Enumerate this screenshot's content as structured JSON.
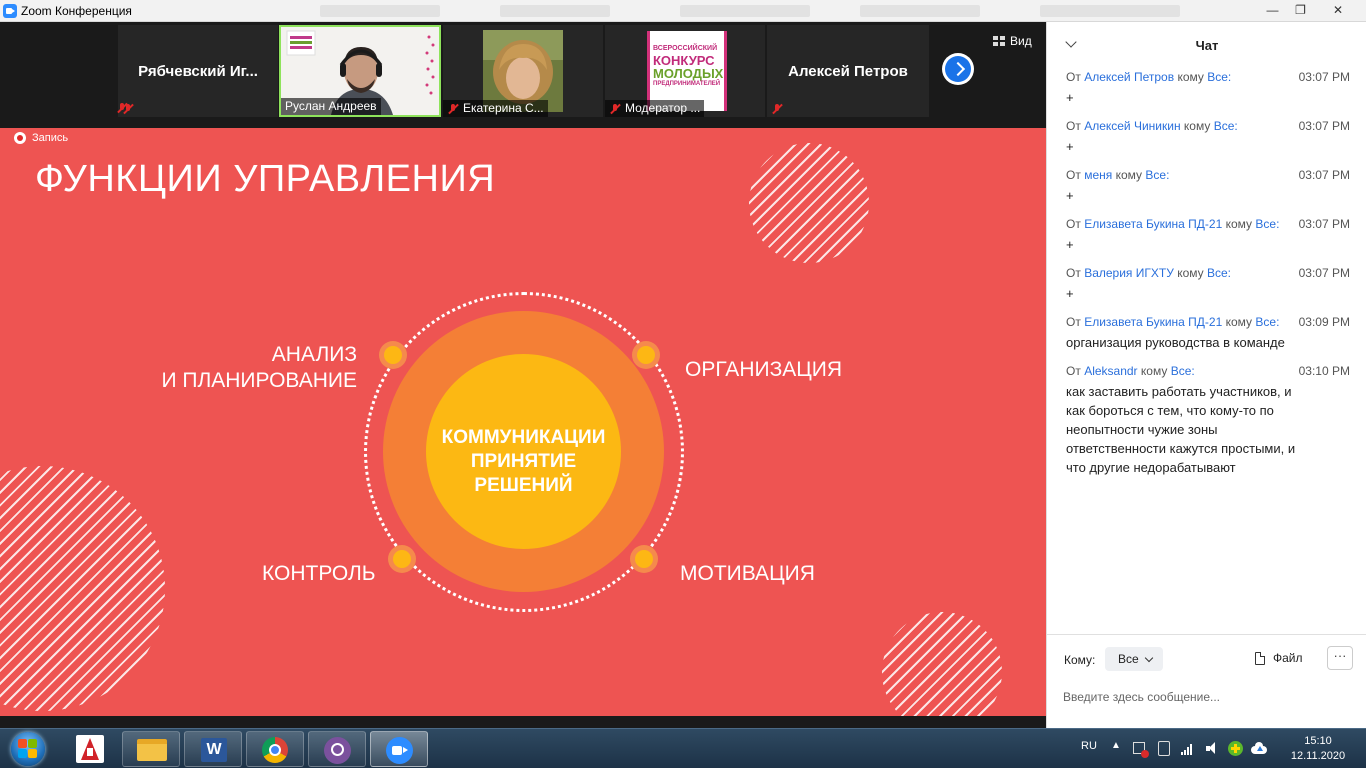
{
  "window": {
    "title": "Zoom Конференция"
  },
  "gallery": {
    "tiles": [
      {
        "name": "Рябчевский  Иг...",
        "label": ""
      },
      {
        "name": "",
        "label": "Руслан Андреев"
      },
      {
        "name": "",
        "label": "Екатерина С..."
      },
      {
        "name": "",
        "label": "Модератор ..."
      },
      {
        "name": "Алексей Петров",
        "label": ""
      }
    ],
    "view_label": "Вид",
    "logo_konkurs": {
      "line1": "ВСЕРОССИЙСКИЙ",
      "line2": "КОНКУРС",
      "line3": "МОЛОДЫХ",
      "line4": "ПРЕДПРИНИМАТЕЛЕЙ"
    }
  },
  "recording": {
    "label": "Запись"
  },
  "slide": {
    "title": "ФУНКЦИИ УПРАВЛЕНИЯ",
    "center": [
      "КОММУНИКАЦИИ",
      "ПРИНЯТИЕ",
      "РЕШЕНИЙ"
    ],
    "analysis": [
      "АНАЛИЗ",
      "И ПЛАНИРОВАНИЕ"
    ],
    "organization": "ОРГАНИЗАЦИЯ",
    "control": "КОНТРОЛЬ",
    "motivation": "МОТИВАЦИЯ"
  },
  "chat": {
    "title": "Чат",
    "from_word": "От",
    "to_word": "кому",
    "messages": [
      {
        "sender": "Алексей Петров",
        "recipient": "Все:",
        "time": "03:07 PM",
        "text": "+"
      },
      {
        "sender": "Алексей Чиникин",
        "recipient": "Все:",
        "time": "03:07 PM",
        "text": "+"
      },
      {
        "sender": "меня",
        "recipient": "Все:",
        "time": "03:07 PM",
        "text": "+"
      },
      {
        "sender": "Елизавета Букина ПД-21",
        "recipient": "Все:",
        "time": "03:07 PM",
        "text": "+"
      },
      {
        "sender": "Валерия ИГХТУ",
        "recipient": "Все:",
        "time": "03:07 PM",
        "text": "+"
      },
      {
        "sender": "Елизавета Букина ПД-21",
        "recipient": "Все:",
        "time": "03:09 PM",
        "text": "организация руководства в команде"
      },
      {
        "sender": "Aleksandr",
        "recipient": "Все:",
        "time": "03:10 PM",
        "text": "как заставить работать участников, и\nкак бороться с тем, что кому-то по\nнеопытности чужие зоны\nответственности кажутся простыми, и\nчто другие недорабатывают"
      }
    ],
    "to_label": "Кому:",
    "to_value": "Все",
    "file_label": "Файл",
    "more_label": "···",
    "input_placeholder": "Введите здесь сообщение..."
  },
  "taskbar": {
    "language": "RU",
    "time": "15:10",
    "date": "12.11.2020"
  },
  "colors": {
    "slide_bg": "#ee5452",
    "ring_orange": "#f47f36",
    "core_yellow": "#fcb813",
    "chat_link": "#2a6fdb",
    "zoom_blue": "#2d8cff"
  }
}
